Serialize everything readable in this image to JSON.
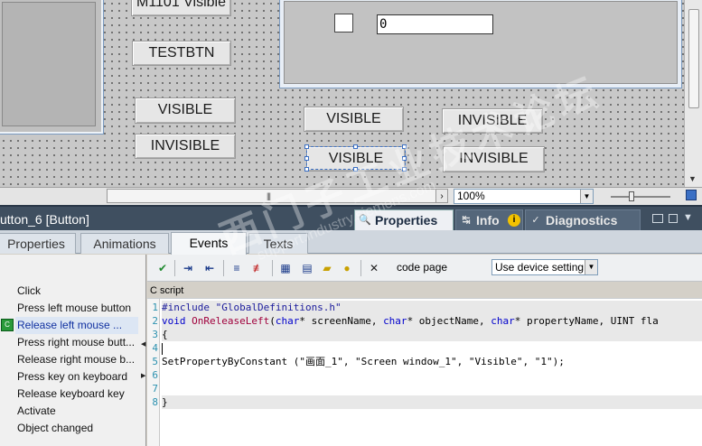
{
  "canvas": {
    "truncated_label": "M1101 Visible",
    "io_field_value": "0",
    "buttons": {
      "testbtn": "TESTBTN",
      "visible_left": "VISIBLE",
      "invisible_left": "INVISIBLE",
      "visible_mid_top": "VISIBLE",
      "invisible_right_top": "INVISIBLE",
      "visible_mid_bottom": "VISIBLE",
      "invisible_right_bottom": "INVISIBLE"
    }
  },
  "hbar": {
    "grip": "|||",
    "zoom": "100%"
  },
  "inspector": {
    "title": "utton_6 [Button]",
    "tabs": [
      {
        "label": "Properties",
        "icon": "properties-icon"
      },
      {
        "label": "Info",
        "icon": "info-icon"
      },
      {
        "label": "Diagnostics",
        "icon": "diagnostics-icon"
      }
    ],
    "info_badge": "i"
  },
  "subtabs": [
    "Properties",
    "Animations",
    "Events",
    "Texts"
  ],
  "events": [
    "Click",
    "Press left mouse button",
    "Release left mouse ...",
    "Press right mouse butt...",
    "Release right mouse b...",
    "Press key on keyboard",
    "Release keyboard key",
    "Activate",
    "Object changed"
  ],
  "toolbar": {
    "code_page_label": "code page",
    "code_page_value": "Use device setting"
  },
  "editor": {
    "label": "C script",
    "line_numbers": [
      "1",
      "2",
      "3",
      "4",
      "5",
      "6",
      "7",
      "8"
    ],
    "line1": "#include \"GlobalDefinitions.h\"",
    "line2_kw_void": "void",
    "line2_fn": "OnReleaseLeft",
    "line2_rest_a": "(",
    "line2_kw_char1": "char",
    "line2_rest_b": "* screenName, ",
    "line2_kw_char2": "char",
    "line2_rest_c": "* objectName, ",
    "line2_kw_char3": "char",
    "line2_rest_d": "* propertyName, UINT fla",
    "line3": "{",
    "line5_fn": "SetPropertyByConstant",
    "line5_args": " (\"画面_1\", \"Screen window_1\", \"Visible\", \"1\");",
    "line8": "}"
  },
  "watermark": {
    "main": "西门子工业技术论坛",
    "sub": "support.industry.siemens.com"
  },
  "colors": {
    "inspector_header": "#3f4f60",
    "selection": "#3a6fc4",
    "keyword": "#0000cc",
    "function": "#a0003c"
  }
}
